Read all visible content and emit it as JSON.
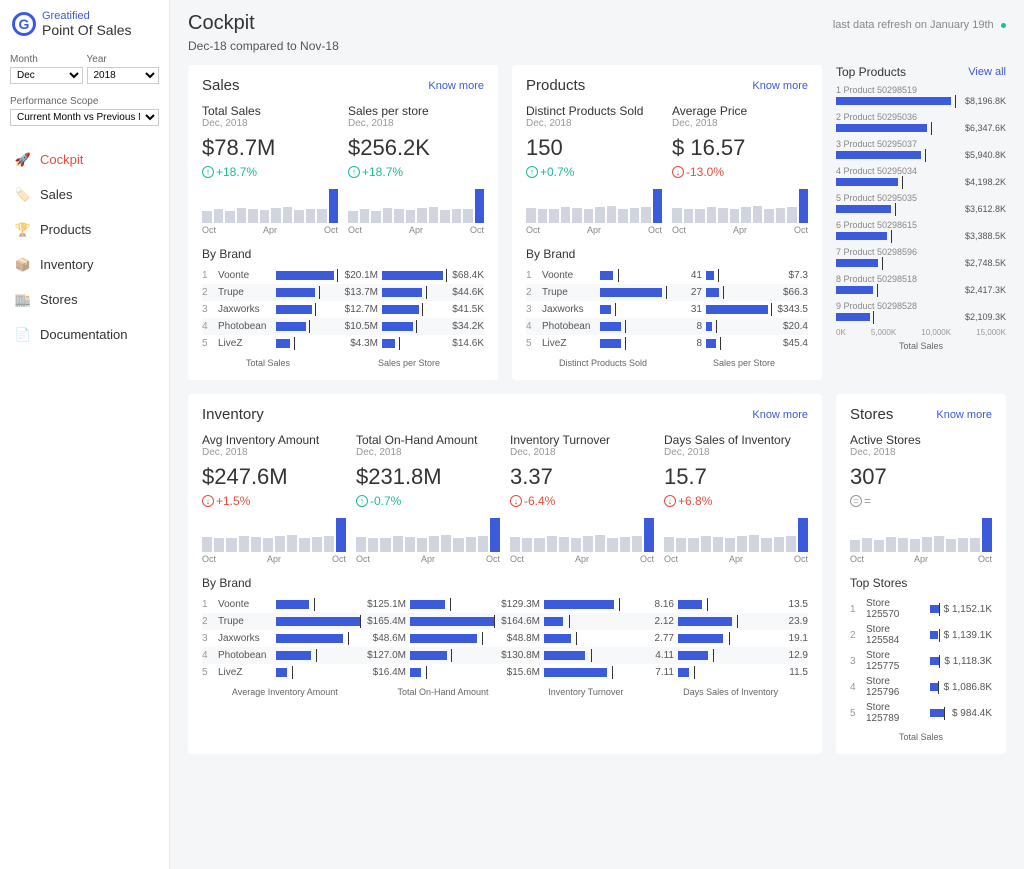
{
  "brand": {
    "t1": "Greatified",
    "t2": "Point Of Sales"
  },
  "filters": {
    "month_label": "Month",
    "year_label": "Year",
    "month_value": "Dec",
    "year_value": "2018",
    "scope_label": "Performance Scope",
    "scope_value": "Current Month vs Previous Month"
  },
  "nav": {
    "items": [
      {
        "label": "Cockpit",
        "icon": "rocket",
        "active": true
      },
      {
        "label": "Sales",
        "icon": "tag"
      },
      {
        "label": "Products",
        "icon": "trophy"
      },
      {
        "label": "Inventory",
        "icon": "box"
      },
      {
        "label": "Stores",
        "icon": "store"
      },
      {
        "label": "Documentation",
        "icon": "doc"
      }
    ]
  },
  "page": {
    "title": "Cockpit",
    "refresh_text": "last data refresh on January 19th",
    "subtitle": "Dec-18 compared to Nov-18",
    "know_more": "Know more",
    "view_all": "View all"
  },
  "sales": {
    "title": "Sales",
    "total": {
      "label": "Total Sales",
      "sub": "Dec, 2018",
      "value": "$78.7M",
      "delta": "+18.7%",
      "dir": "pos"
    },
    "per_store": {
      "label": "Sales per store",
      "sub": "Dec, 2018",
      "value": "$256.2K",
      "delta": "+18.7%",
      "dir": "pos"
    },
    "by_brand_label": "By Brand",
    "brands": [
      {
        "rank": "1",
        "name": "Voonte",
        "v1": "$20.1M",
        "b1": 88,
        "v2": "$68.4K",
        "b2": 90
      },
      {
        "rank": "2",
        "name": "Trupe",
        "v1": "$13.7M",
        "b1": 60,
        "v2": "$44.6K",
        "b2": 60
      },
      {
        "rank": "3",
        "name": "Jaxworks",
        "v1": "$12.7M",
        "b1": 55,
        "v2": "$41.5K",
        "b2": 55
      },
      {
        "rank": "4",
        "name": "Photobean",
        "v1": "$10.5M",
        "b1": 46,
        "v2": "$34.2K",
        "b2": 46
      },
      {
        "rank": "5",
        "name": "LiveZ",
        "v1": "$4.3M",
        "b1": 20,
        "v2": "$14.6K",
        "b2": 20
      }
    ],
    "chart_labels": [
      "Total Sales",
      "Sales per Store"
    ]
  },
  "products": {
    "title": "Products",
    "distinct": {
      "label": "Distinct Products Sold",
      "sub": "Dec, 2018",
      "value": "150",
      "delta": "+0.7%",
      "dir": "pos"
    },
    "avg_price": {
      "label": "Average Price",
      "sub": "Dec, 2018",
      "value": "$ 16.57",
      "delta": "-13.0%",
      "dir": "neg"
    },
    "by_brand_label": "By Brand",
    "brands": [
      {
        "rank": "1",
        "name": "Voonte",
        "v1": "41",
        "b1": 15,
        "v2": "$7.3",
        "b2": 10
      },
      {
        "rank": "2",
        "name": "Trupe",
        "v1": "27",
        "b1": 70,
        "v2": "$66.3",
        "b2": 18
      },
      {
        "rank": "3",
        "name": "Jaxworks",
        "v1": "31",
        "b1": 12,
        "v2": "$343.5",
        "b2": 90
      },
      {
        "rank": "4",
        "name": "Photobean",
        "v1": "8",
        "b1": 22,
        "v2": "$20.4",
        "b2": 8
      },
      {
        "rank": "5",
        "name": "LiveZ",
        "v1": "8",
        "b1": 22,
        "v2": "$45.4",
        "b2": 14
      }
    ],
    "chart_labels": [
      "Distinct Products Sold",
      "Sales per Store"
    ]
  },
  "top_products": {
    "title": "Top Products",
    "items": [
      {
        "rank": "1",
        "name": "Product 50298519",
        "value": "$8,196.8K",
        "bar": 92
      },
      {
        "rank": "2",
        "name": "Product 50295036",
        "value": "$6,347.6K",
        "bar": 73
      },
      {
        "rank": "3",
        "name": "Product 50295037",
        "value": "$5,940.8K",
        "bar": 68
      },
      {
        "rank": "4",
        "name": "Product 50295034",
        "value": "$4,198.2K",
        "bar": 50
      },
      {
        "rank": "5",
        "name": "Product 50295035",
        "value": "$3,612.8K",
        "bar": 44
      },
      {
        "rank": "6",
        "name": "Product 50298615",
        "value": "$3,388.5K",
        "bar": 41
      },
      {
        "rank": "7",
        "name": "Product 50298596",
        "value": "$2,748.5K",
        "bar": 34
      },
      {
        "rank": "8",
        "name": "Product 50298518",
        "value": "$2,417.3K",
        "bar": 30
      },
      {
        "rank": "9",
        "name": "Product 50298528",
        "value": "$2,109.3K",
        "bar": 27
      }
    ],
    "axis": [
      "0K",
      "5,000K",
      "10,000K",
      "15,000K"
    ],
    "footer": "Total Sales"
  },
  "inventory": {
    "title": "Inventory",
    "kpis": [
      {
        "label": "Avg Inventory Amount",
        "sub": "Dec, 2018",
        "value": "$247.6M",
        "delta": "+1.5%",
        "dir": "neg"
      },
      {
        "label": "Total On-Hand Amount",
        "sub": "Dec, 2018",
        "value": "$231.8M",
        "delta": "-0.7%",
        "dir": "pos"
      },
      {
        "label": "Inventory Turnover",
        "sub": "Dec, 2018",
        "value": "3.37",
        "delta": "-6.4%",
        "dir": "neg"
      },
      {
        "label": "Days Sales of Inventory",
        "sub": "Dec, 2018",
        "value": "15.7",
        "delta": "+6.8%",
        "dir": "neg"
      }
    ],
    "by_brand_label": "By Brand",
    "brands": [
      {
        "rank": "1",
        "name": "Voonte",
        "vals": [
          [
            "$125.1M",
            38
          ],
          [
            "$129.3M",
            40
          ],
          [
            "8.16",
            65
          ],
          [
            "13.5",
            22
          ]
        ]
      },
      {
        "rank": "2",
        "name": "Trupe",
        "vals": [
          [
            "$165.4M",
            95
          ],
          [
            "$164.6M",
            95
          ],
          [
            "2.12",
            18
          ],
          [
            "23.9",
            50
          ]
        ]
      },
      {
        "rank": "3",
        "name": "Jaxworks",
        "vals": [
          [
            "$48.6M",
            72
          ],
          [
            "$48.8M",
            72
          ],
          [
            "2.77",
            25
          ],
          [
            "19.1",
            42
          ]
        ]
      },
      {
        "rank": "4",
        "name": "Photobean",
        "vals": [
          [
            "$127.0M",
            40
          ],
          [
            "$130.8M",
            42
          ],
          [
            "4.11",
            38
          ],
          [
            "12.9",
            28
          ]
        ]
      },
      {
        "rank": "5",
        "name": "LiveZ",
        "vals": [
          [
            "$16.4M",
            12
          ],
          [
            "$15.6M",
            12
          ],
          [
            "7.11",
            58
          ],
          [
            "11.5",
            10
          ]
        ]
      }
    ],
    "chart_labels": [
      "Average Inventory Amount",
      "Total On-Hand Amount",
      "Inventory Turnover",
      "Days Sales of Inventory"
    ]
  },
  "stores": {
    "title": "Stores",
    "active": {
      "label": "Active Stores",
      "sub": "Dec, 2018",
      "value": "307",
      "delta": "=",
      "dir": "gray"
    },
    "top_label": "Top Stores",
    "items": [
      {
        "rank": "1",
        "name": "Store 125570",
        "value": "$ 1,152.1K",
        "bar": 90
      },
      {
        "rank": "2",
        "name": "Store 125584",
        "value": "$ 1,139.1K",
        "bar": 88
      },
      {
        "rank": "3",
        "name": "Store 125775",
        "value": "$ 1,118.3K",
        "bar": 86
      },
      {
        "rank": "4",
        "name": "Store 125796",
        "value": "$ 1,086.8K",
        "bar": 84
      },
      {
        "rank": "5",
        "name": "Store 125789",
        "value": "$ 984.4K",
        "bar": 76
      }
    ],
    "footer": "Total Sales"
  },
  "chart_data": {
    "mini_heights": [
      35,
      40,
      35,
      45,
      42,
      38,
      44,
      46,
      38,
      40,
      42,
      100
    ],
    "mini_heights2": [
      45,
      42,
      40,
      48,
      44,
      40,
      46,
      50,
      42,
      44,
      46,
      100
    ],
    "axis_labels": [
      "Oct",
      "Apr",
      "Oct"
    ]
  }
}
